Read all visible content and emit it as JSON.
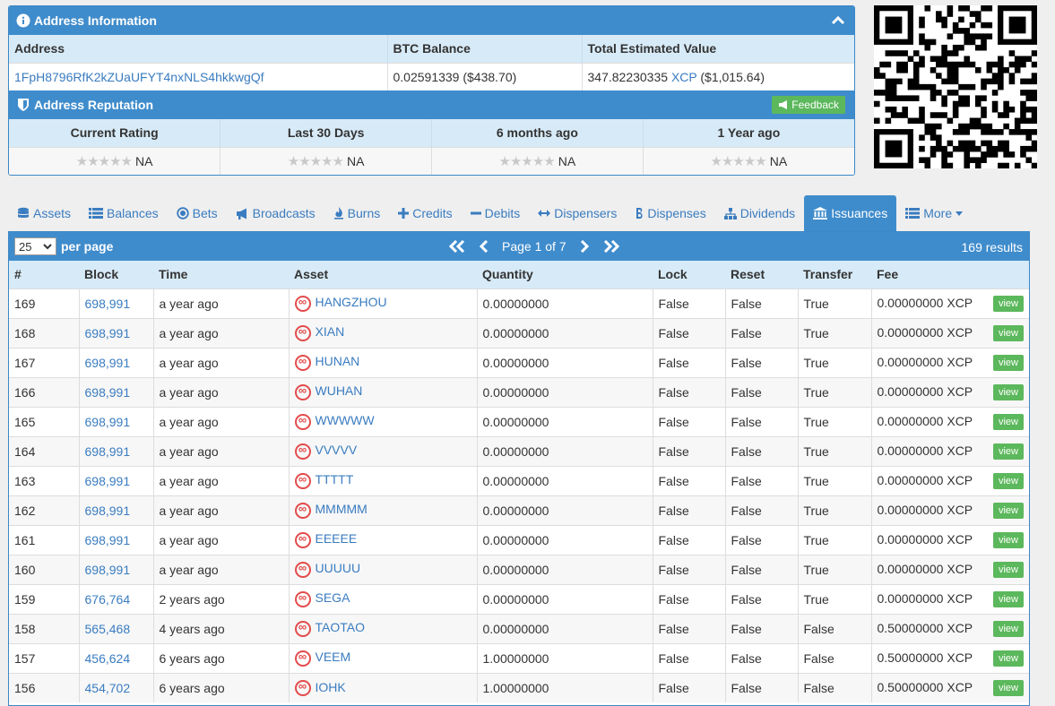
{
  "address_panel": {
    "title": "Address Information",
    "columns": [
      "Address",
      "BTC Balance",
      "Total Estimated Value"
    ],
    "address": "1FpH8796RfK2kZUaUFYT4nxNLS4hkkwgQf",
    "btc_balance": "0.02591339 ($438.70)",
    "total_value_amount": "347.82230335",
    "total_value_unit": "XCP",
    "total_value_usd": "($1,015.64)"
  },
  "reputation": {
    "title": "Address Reputation",
    "feedback_label": "Feedback",
    "columns": [
      "Current Rating",
      "Last 30 Days",
      "6 months ago",
      "1 Year ago"
    ],
    "values": [
      "NA",
      "NA",
      "NA",
      "NA"
    ]
  },
  "tabs": [
    {
      "label": "Assets",
      "icon": "database-icon"
    },
    {
      "label": "Balances",
      "icon": "list-icon"
    },
    {
      "label": "Bets",
      "icon": "circle-dot-icon"
    },
    {
      "label": "Broadcasts",
      "icon": "bullhorn-icon"
    },
    {
      "label": "Burns",
      "icon": "fire-icon"
    },
    {
      "label": "Credits",
      "icon": "plus-icon"
    },
    {
      "label": "Debits",
      "icon": "minus-icon"
    },
    {
      "label": "Dispensers",
      "icon": "arrows-h-icon"
    },
    {
      "label": "Dispenses",
      "icon": "bitcoin-icon"
    },
    {
      "label": "Dividends",
      "icon": "sitemap-icon"
    },
    {
      "label": "Issuances",
      "icon": "bank-icon",
      "active": true
    },
    {
      "label": "More",
      "icon": "list-icon"
    }
  ],
  "issuances": {
    "per_page_value": "25",
    "per_page_label": "per page",
    "page_label": "Page 1 of 7",
    "results_label": "169 results",
    "columns": [
      "#",
      "Block",
      "Time",
      "Asset",
      "Quantity",
      "Lock",
      "Reset",
      "Transfer",
      "Fee"
    ],
    "view_label": "view",
    "rows": [
      {
        "id": "169",
        "block": "698,991",
        "time": "a year ago",
        "asset": "HANGZHOU",
        "quantity": "0.00000000",
        "lock": "False",
        "reset": "False",
        "transfer": "True",
        "fee": "0.00000000 XCP"
      },
      {
        "id": "168",
        "block": "698,991",
        "time": "a year ago",
        "asset": "XIAN",
        "quantity": "0.00000000",
        "lock": "False",
        "reset": "False",
        "transfer": "True",
        "fee": "0.00000000 XCP"
      },
      {
        "id": "167",
        "block": "698,991",
        "time": "a year ago",
        "asset": "HUNAN",
        "quantity": "0.00000000",
        "lock": "False",
        "reset": "False",
        "transfer": "True",
        "fee": "0.00000000 XCP"
      },
      {
        "id": "166",
        "block": "698,991",
        "time": "a year ago",
        "asset": "WUHAN",
        "quantity": "0.00000000",
        "lock": "False",
        "reset": "False",
        "transfer": "True",
        "fee": "0.00000000 XCP"
      },
      {
        "id": "165",
        "block": "698,991",
        "time": "a year ago",
        "asset": "WWWWW",
        "quantity": "0.00000000",
        "lock": "False",
        "reset": "False",
        "transfer": "True",
        "fee": "0.00000000 XCP"
      },
      {
        "id": "164",
        "block": "698,991",
        "time": "a year ago",
        "asset": "VVVVV",
        "quantity": "0.00000000",
        "lock": "False",
        "reset": "False",
        "transfer": "True",
        "fee": "0.00000000 XCP"
      },
      {
        "id": "163",
        "block": "698,991",
        "time": "a year ago",
        "asset": "TTTTT",
        "quantity": "0.00000000",
        "lock": "False",
        "reset": "False",
        "transfer": "True",
        "fee": "0.00000000 XCP"
      },
      {
        "id": "162",
        "block": "698,991",
        "time": "a year ago",
        "asset": "MMMMM",
        "quantity": "0.00000000",
        "lock": "False",
        "reset": "False",
        "transfer": "True",
        "fee": "0.00000000 XCP"
      },
      {
        "id": "161",
        "block": "698,991",
        "time": "a year ago",
        "asset": "EEEEE",
        "quantity": "0.00000000",
        "lock": "False",
        "reset": "False",
        "transfer": "True",
        "fee": "0.00000000 XCP"
      },
      {
        "id": "160",
        "block": "698,991",
        "time": "a year ago",
        "asset": "UUUUU",
        "quantity": "0.00000000",
        "lock": "False",
        "reset": "False",
        "transfer": "True",
        "fee": "0.00000000 XCP"
      },
      {
        "id": "159",
        "block": "676,764",
        "time": "2 years ago",
        "asset": "SEGA",
        "quantity": "0.00000000",
        "lock": "False",
        "reset": "False",
        "transfer": "True",
        "fee": "0.00000000 XCP"
      },
      {
        "id": "158",
        "block": "565,468",
        "time": "4 years ago",
        "asset": "TAOTAO",
        "quantity": "0.00000000",
        "lock": "False",
        "reset": "False",
        "transfer": "False",
        "fee": "0.50000000 XCP"
      },
      {
        "id": "157",
        "block": "456,624",
        "time": "6 years ago",
        "asset": "VEEM",
        "quantity": "1.00000000",
        "lock": "False",
        "reset": "False",
        "transfer": "False",
        "fee": "0.50000000 XCP"
      },
      {
        "id": "156",
        "block": "454,702",
        "time": "6 years ago",
        "asset": "IOHK",
        "quantity": "1.00000000",
        "lock": "False",
        "reset": "False",
        "transfer": "False",
        "fee": "0.50000000 XCP"
      }
    ]
  }
}
